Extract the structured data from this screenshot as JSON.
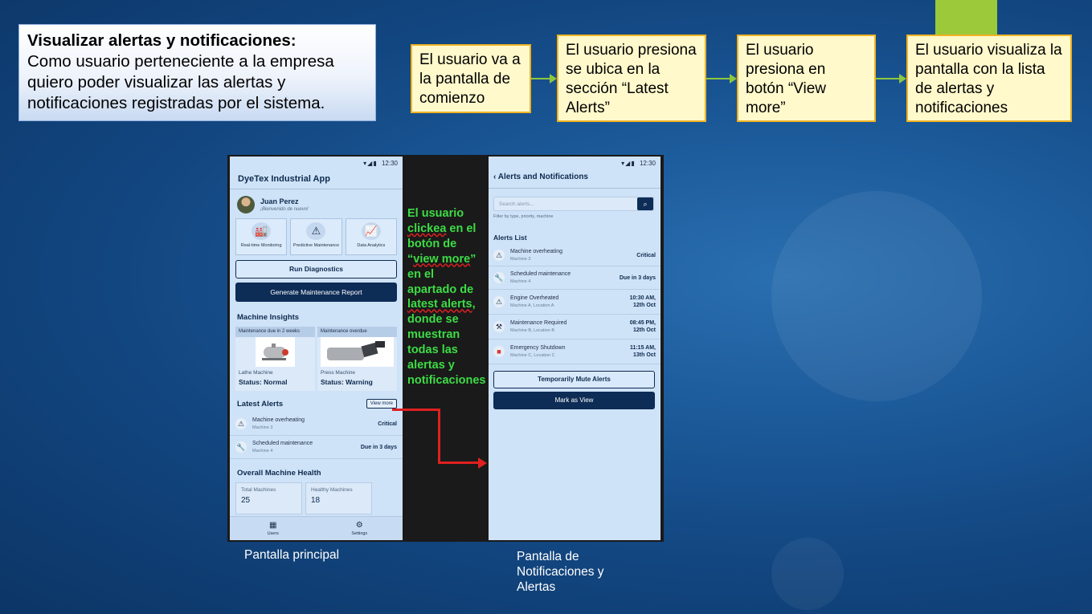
{
  "story": {
    "title": "Visualizar alertas y notificaciones:",
    "text": "Como usuario perteneciente a la empresa quiero poder visualizar las alertas y notificaciones registradas por el sistema."
  },
  "flow_steps": [
    "El usuario va a la pantalla de comienzo",
    "El usuario presiona se ubica en la sección “Latest Alerts”",
    "El usuario presiona en botón “View more”",
    "El usuario visualiza la pantalla con la lista de alertas y notificaciones"
  ],
  "note": {
    "part1": "El usuario ",
    "clickea": "clickea",
    "part2": " en el botón de “",
    "view_more": "view more",
    "part3": "” en el apartado de ",
    "latest_alerts": "latest alerts",
    "part4": ", donde se muestran todas las alertas y notificaciones"
  },
  "main_screen": {
    "time": "12:30",
    "app_title": "DyeTex Industrial App",
    "user_name": "Juan Perez",
    "user_greeting": "¡Bienvenido de nuevo!",
    "tiles": [
      "Real-time Monitoring",
      "Predictive Maintenance",
      "Data Analytics"
    ],
    "run_diagnostics": "Run Diagnostics",
    "generate_report": "Generate Maintenance Report",
    "insights_title": "Machine Insights",
    "insights": [
      {
        "header": "Maintenance due in 2 weeks",
        "machine": "Lathe Machine",
        "status": "Status: Normal"
      },
      {
        "header": "Maintenance overdue",
        "machine": "Press Machine",
        "status": "Status: Warning"
      }
    ],
    "latest_alerts_title": "Latest Alerts",
    "view_more": "View more",
    "alerts": [
      {
        "title": "Machine overheating",
        "sub": "Machine 3",
        "right": "Critical"
      },
      {
        "title": "Scheduled maintenance",
        "sub": "Machine 4",
        "right": "Due in 3 days"
      }
    ],
    "health_title": "Overall Machine Health",
    "stats": [
      {
        "label": "Total Machines",
        "value": "25"
      },
      {
        "label": "Healthy Machines",
        "value": "18"
      }
    ],
    "nav": [
      "Users",
      "Settings"
    ]
  },
  "alerts_screen": {
    "time": "12:30",
    "title": "Alerts and Notifications",
    "search_placeholder": "Search alerts...",
    "filter_hint": "Filter by type, priority, machine",
    "list_title": "Alerts List",
    "alerts": [
      {
        "title": "Machine overheating",
        "sub": "Machine 3",
        "right1": "Critical",
        "right2": ""
      },
      {
        "title": "Scheduled maintenance",
        "sub": "Machine 4",
        "right1": "Due in 3 days",
        "right2": ""
      },
      {
        "title": "Engine Overheated",
        "sub": "Machine A, Location A",
        "right1": "10:30 AM,",
        "right2": "12th Oct"
      },
      {
        "title": "Maintenance Required",
        "sub": "Machine B, Location B",
        "right1": "08:45 PM,",
        "right2": "12th Oct"
      },
      {
        "title": "Emergency Shutdown",
        "sub": "Machine C, Location C",
        "right1": "11:15 AM,",
        "right2": "13th Oct"
      }
    ],
    "mute_button": "Temporarily Mute Alerts",
    "mark_button": "Mark as View"
  },
  "captions": {
    "main": "Pantalla principal",
    "alerts": "Pantalla de Notificaciones y Alertas"
  },
  "colors": {
    "step_border": "#f0b323",
    "step_fill": "#fff9cc",
    "flow_arrow": "#8dc63f",
    "note_text": "#3ddc45",
    "pointer_arrow": "#e02020",
    "app_primary": "#0d2c56"
  }
}
